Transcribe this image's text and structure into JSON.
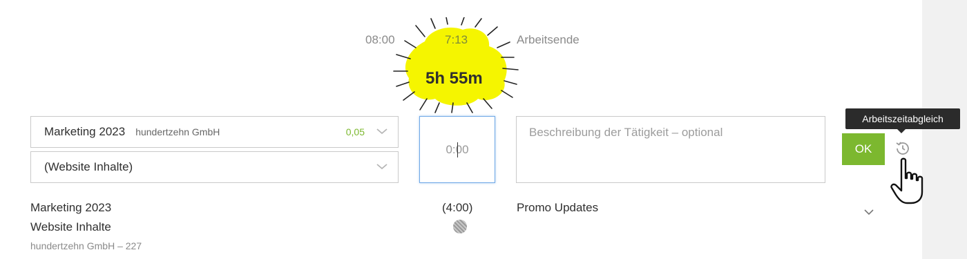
{
  "timeline": {
    "start": "08:00",
    "current": "7:13",
    "end_label": "Arbeitsende",
    "duration": "5h 55m"
  },
  "form": {
    "project": {
      "name": "Marketing 2023",
      "client": "hundertzehn GmbH",
      "value": "0,05"
    },
    "task": {
      "name": "(Website Inhalte)"
    },
    "time_value": "0:00",
    "description_placeholder": "Beschreibung der Tätigkeit – optional",
    "ok_label": "OK",
    "tooltip": "Arbeitszeitabgleich"
  },
  "entry": {
    "project": "Marketing 2023",
    "task": "Website Inhalte",
    "client_line": "hundertzehn GmbH – 227",
    "duration": "(4:00)",
    "description": "Promo Updates"
  },
  "colors": {
    "accent_green": "#7cb82f",
    "highlight_yellow": "#f5f500",
    "focus_blue": "#6ea8e6",
    "tooltip_bg": "#2b2b2b"
  },
  "icons": [
    "chevron-down-icon",
    "history-icon",
    "hand-cursor-icon",
    "status-dot-icon"
  ]
}
